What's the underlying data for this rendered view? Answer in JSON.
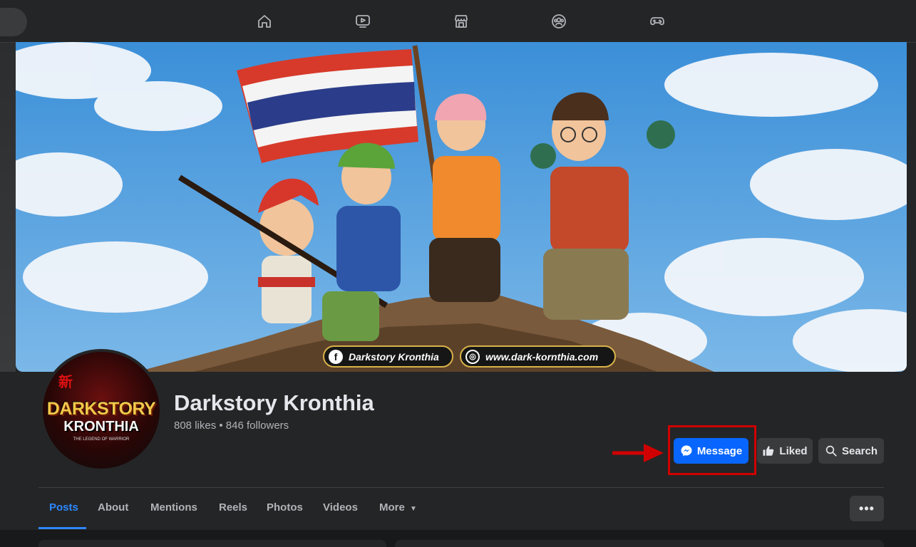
{
  "nav": {
    "icons": [
      "home-icon",
      "watch-icon",
      "marketplace-icon",
      "groups-icon",
      "gaming-icon"
    ]
  },
  "cover": {
    "pill_page": "Darkstory Kronthia",
    "pill_site": "www.dark-kornthia.com"
  },
  "avatar": {
    "line1": "DARKSTORY",
    "line2": "KRONTHIA",
    "kanji": "新",
    "line3": "THE LEGEND OF WARRIOR"
  },
  "page": {
    "name": "Darkstory Kronthia",
    "stats": "808 likes • 846 followers"
  },
  "actions": {
    "message": "Message",
    "liked": "Liked",
    "search": "Search"
  },
  "tabs": {
    "posts": "Posts",
    "about": "About",
    "mentions": "Mentions",
    "reels": "Reels",
    "photos": "Photos",
    "videos": "Videos",
    "more": "More"
  },
  "colors": {
    "accent": "#0866ff",
    "tab_active": "#2d88ff",
    "highlight": "#d10000"
  }
}
